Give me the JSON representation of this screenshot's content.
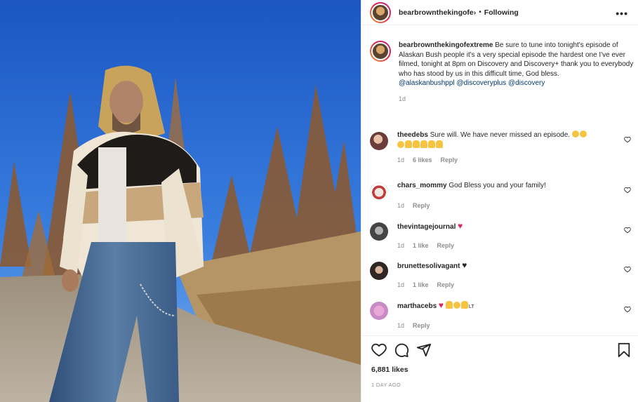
{
  "post": {
    "username": "bearbrownthekingofextreme",
    "username_truncated": "bearbrownthekingofe›",
    "separator": "•",
    "follow_status": "Following",
    "more_glyph": "•••",
    "caption_body": "Be sure to tune into tonight's episode of Alaskan Bush people it's a very special episode the hardest one I've ever filmed, tonight at 8pm on Discovery and Discovery+ thank you to everybody who has stood by us in this difficult time, God bless.",
    "mentions": [
      "@alaskanbushppl",
      "@discoveryplus",
      "@discovery"
    ],
    "caption_time": "1d",
    "likes": "6,881 likes",
    "posted_ago": "1 DAY AGO"
  },
  "comments": [
    {
      "username": "theedebs",
      "text": "Sure will. We have never missed an episode.",
      "emoji_line_icons": [
        "disappointed-face-icon",
        "disappointed-face-icon",
        "disappointed-face-icon",
        "folded-hands-icon",
        "folded-hands-icon",
        "folded-hands-icon",
        "folded-hands-icon",
        "folded-hands-icon"
      ],
      "time": "1d",
      "likes": "6 likes",
      "reply": "Reply"
    },
    {
      "username": "chars_mommy",
      "text": "God Bless you and your family!",
      "time": "1d",
      "reply": "Reply"
    },
    {
      "username": "thevintagejournal",
      "text": "♥",
      "time": "1d",
      "likes": "1 like",
      "reply": "Reply"
    },
    {
      "username": "brunettesolivagant",
      "text": "♥",
      "time": "1d",
      "likes": "1 like",
      "reply": "Reply"
    },
    {
      "username": "marthacebs",
      "text": "♥",
      "suffix": "LT",
      "time": "1d",
      "reply": "Reply"
    }
  ],
  "icons": {
    "like": "heart-outline-icon",
    "comment": "comment-bubble-icon",
    "share": "paper-plane-icon",
    "save": "bookmark-icon"
  },
  "colors": {
    "link": "#00376b",
    "muted": "#8e8e8e",
    "heart_red": "#e0245e",
    "sky": "#1d5cc4"
  }
}
